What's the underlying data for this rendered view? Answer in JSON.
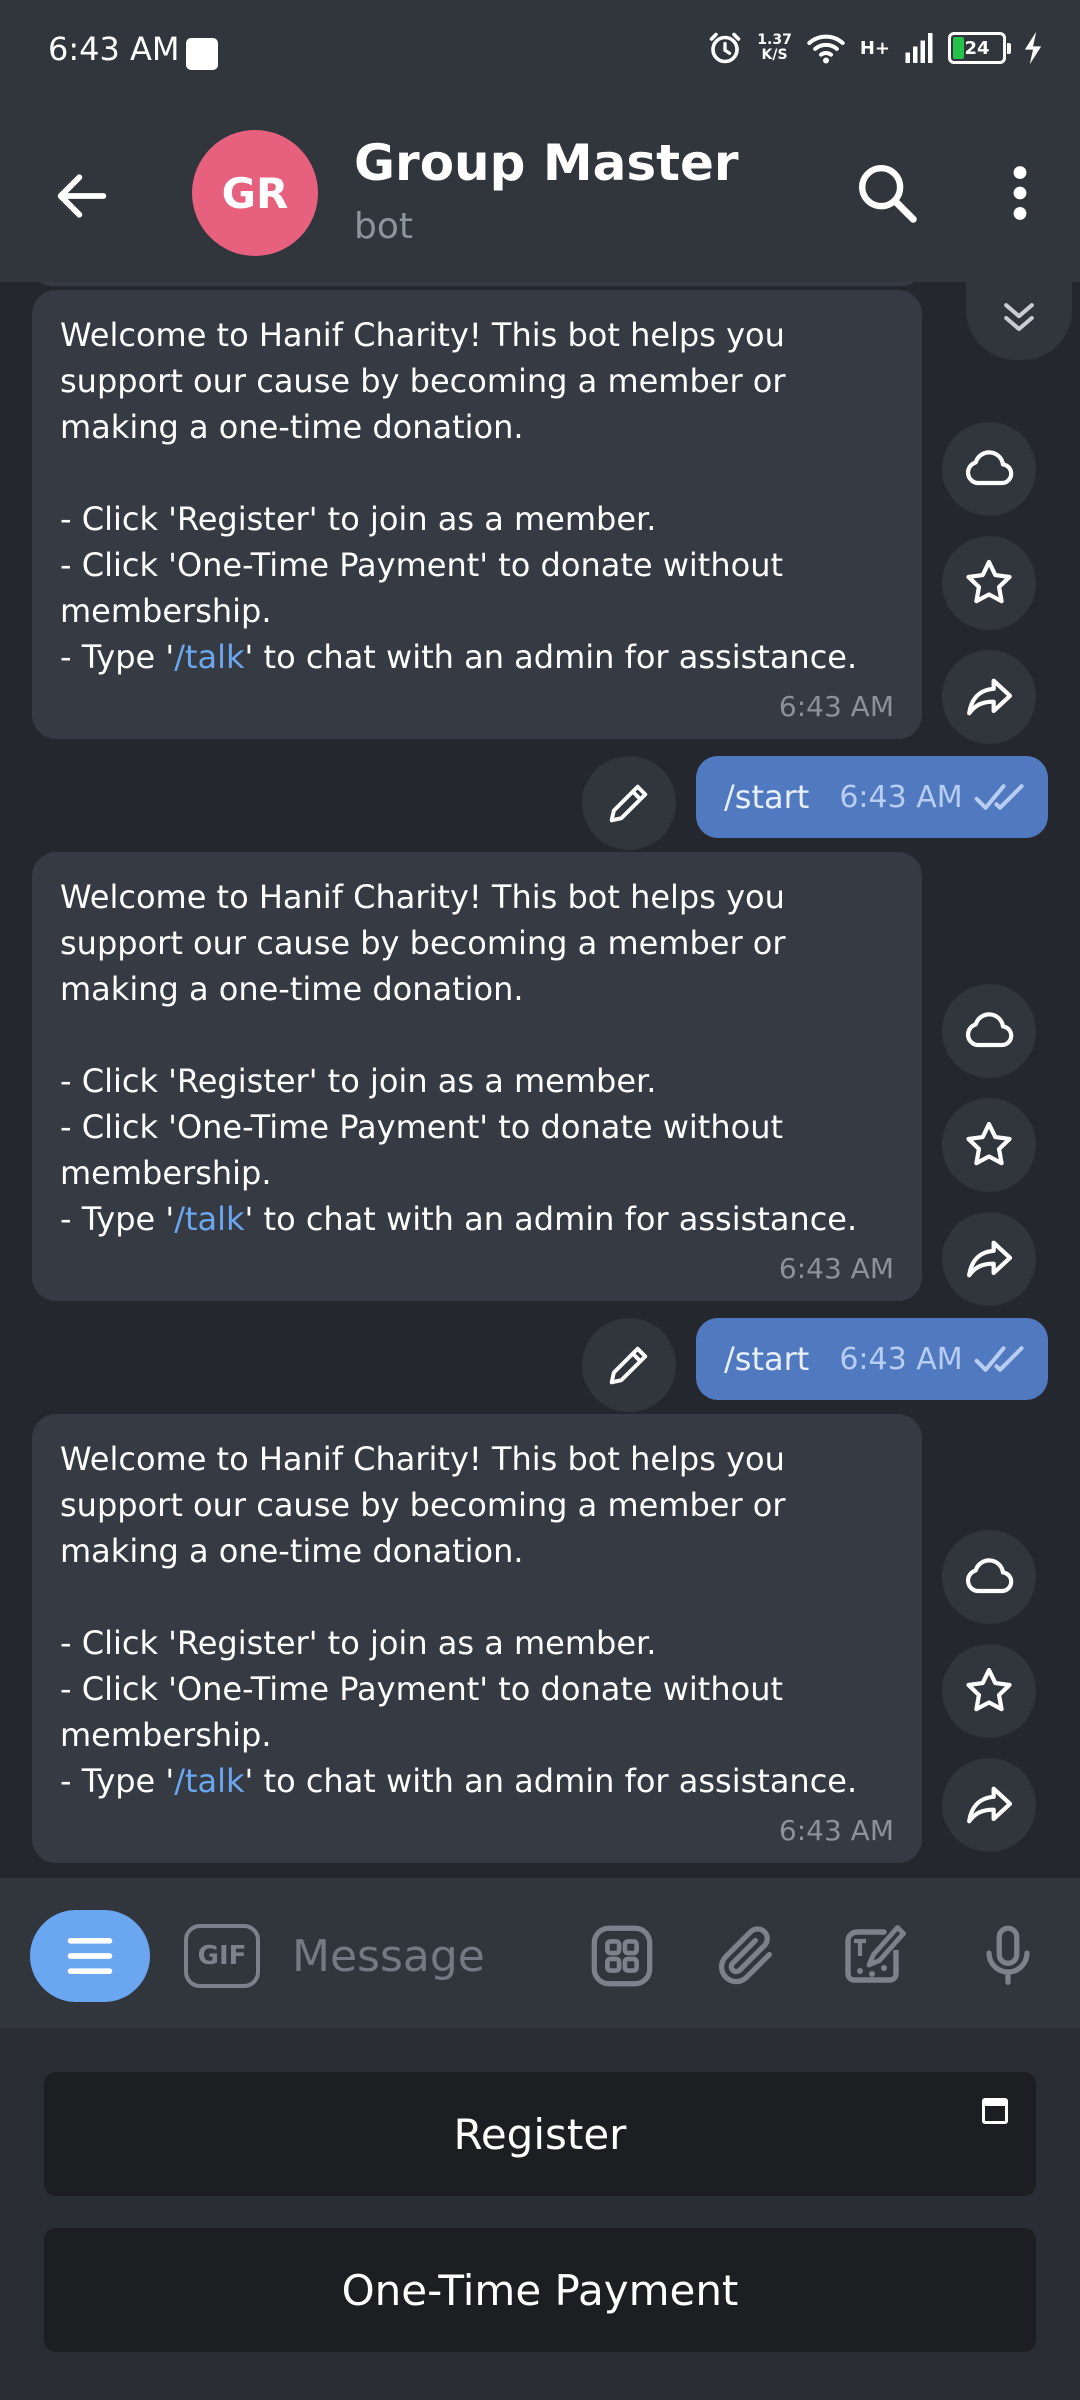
{
  "status_bar": {
    "time": "6:43 AM",
    "speed_value": "1.37",
    "speed_unit": "K/S",
    "network": "H+",
    "battery": "24",
    "battery_level": 0.24,
    "icons": [
      "alarm-icon",
      "wifi-icon",
      "signal-icon",
      "battery-icon",
      "charging-icon"
    ]
  },
  "header": {
    "avatar_initials": "GR",
    "title": "Group Master",
    "subtitle": "bot",
    "avatar_color": "#e7617e"
  },
  "messages": [
    {
      "type": "incoming",
      "intro": "Welcome to Hanif Charity! This bot helps you support our cause by becoming a member or making a one-time donation.",
      "line_register": "- Click 'Register' to join as a member.",
      "line_payment": "- Click 'One-Time Payment' to donate without membership.",
      "line_talk_before": "- Type '",
      "line_talk_link": "/talk",
      "line_talk_after": "' to chat with an admin for assistance.",
      "time": "6:43 AM"
    },
    {
      "type": "outgoing",
      "text": "/start",
      "time": "6:43 AM"
    },
    {
      "type": "incoming",
      "intro": "Welcome to Hanif Charity! This bot helps you support our cause by becoming a member or making a one-time donation.",
      "line_register": "- Click 'Register' to join as a member.",
      "line_payment": "- Click 'One-Time Payment' to donate without membership.",
      "line_talk_before": "- Type '",
      "line_talk_link": "/talk",
      "line_talk_after": "' to chat with an admin for assistance.",
      "time": "6:43 AM"
    },
    {
      "type": "outgoing",
      "text": "/start",
      "time": "6:43 AM"
    },
    {
      "type": "incoming",
      "intro": "Welcome to Hanif Charity! This bot helps you support our cause by becoming a member or making a one-time donation.",
      "line_register": "- Click 'Register' to join as a member.",
      "line_payment": "- Click 'One-Time Payment' to donate without membership.",
      "line_talk_before": "- Type '",
      "line_talk_link": "/talk",
      "line_talk_after": "' to chat with an admin for assistance.",
      "time": "6:43 AM"
    }
  ],
  "composer": {
    "gif_label": "GIF",
    "placeholder": "Message"
  },
  "bot_keyboard": {
    "buttons": [
      "Register",
      "One-Time Payment"
    ]
  },
  "colors": {
    "accent": "#6aa7f0",
    "outgoing_bubble": "#5179c0",
    "incoming_bubble": "#363a42",
    "link": "#6aa7f0"
  }
}
